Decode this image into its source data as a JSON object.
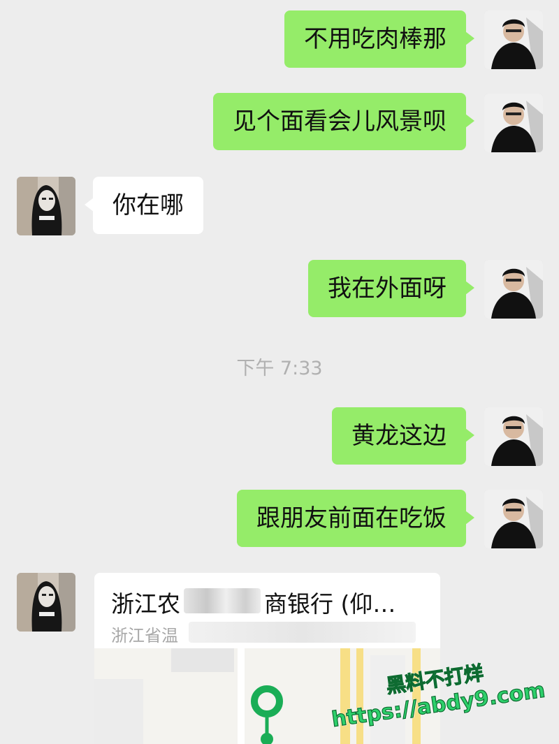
{
  "messages": [
    {
      "side": "out",
      "text": "不用吃肉棒那"
    },
    {
      "side": "out",
      "text": "见个面看会儿风景呗"
    },
    {
      "side": "in",
      "text": "你在哪"
    },
    {
      "side": "out",
      "text": "我在外面呀"
    },
    {
      "side": "out",
      "text": "黄龙这边"
    },
    {
      "side": "out",
      "text": "跟朋友前面在吃饭"
    }
  ],
  "timestamp": "下午 7:33",
  "location_card": {
    "title_start": "浙江农",
    "title_end": "商银行 (仰…",
    "address": "浙江省温"
  },
  "watermark": {
    "line1": "黑料不打烊",
    "line2": "https://abdy9.com"
  },
  "colors": {
    "background": "#ededed",
    "outgoing_bubble": "#95ec69",
    "incoming_bubble": "#ffffff",
    "timestamp": "#b0b0b0",
    "map_pin": "#1aad56",
    "watermark": "#2dd06b"
  },
  "icons": {
    "self_avatar": "male-avatar-photo-icon",
    "other_avatar": "female-avatar-photo-icon",
    "map_pin": "map-pin-icon"
  }
}
